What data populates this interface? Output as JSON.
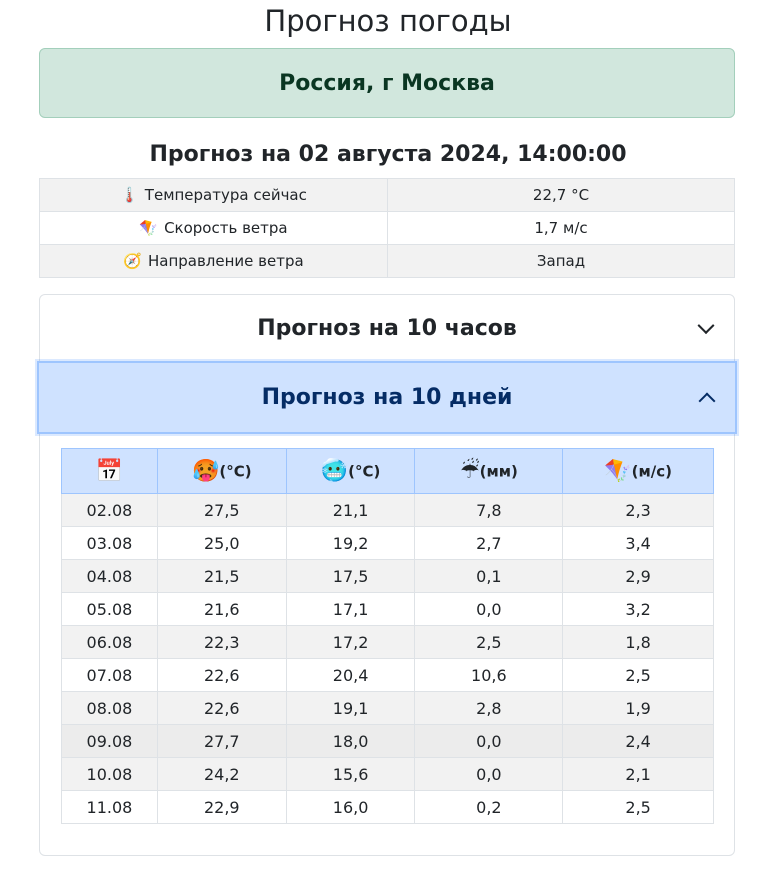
{
  "page_title": "Прогноз погоды",
  "location": "Россия, г Москва",
  "forecast_heading": "Прогноз на 02 августа 2024, 14:00:00",
  "current": [
    {
      "icon": "🌡️",
      "icon_name": "thermometer-icon",
      "label": "Температура сейчас",
      "value": "22,7 °C"
    },
    {
      "icon": "🪁",
      "icon_name": "kite-icon",
      "label": "Скорость ветра",
      "value": "1,7 м/с"
    },
    {
      "icon": "🧭",
      "icon_name": "compass-icon",
      "label": "Направление ветра",
      "value": "Запад"
    }
  ],
  "accordion": {
    "hourly_title": "Прогноз на 10 часов",
    "daily_title": "Прогноз на 10 дней"
  },
  "daily_table": {
    "headers": [
      {
        "icon": "📅",
        "icon_name": "calendar-icon",
        "unit": ""
      },
      {
        "icon": "🥵",
        "icon_name": "hot-face-icon",
        "unit": "(°C)"
      },
      {
        "icon": "🥶",
        "icon_name": "cold-face-icon",
        "unit": "(°C)"
      },
      {
        "icon": "☔",
        "icon_name": "umbrella-rain-icon",
        "unit": "(мм)"
      },
      {
        "icon": "🪁",
        "icon_name": "kite-icon",
        "unit": "(м/с)"
      }
    ],
    "rows": [
      [
        "02.08",
        "27,5",
        "21,1",
        "7,8",
        "2,3"
      ],
      [
        "03.08",
        "25,0",
        "19,2",
        "2,7",
        "3,4"
      ],
      [
        "04.08",
        "21,5",
        "17,5",
        "0,1",
        "2,9"
      ],
      [
        "05.08",
        "21,6",
        "17,1",
        "0,0",
        "3,2"
      ],
      [
        "06.08",
        "22,3",
        "17,2",
        "2,5",
        "1,8"
      ],
      [
        "07.08",
        "22,6",
        "20,4",
        "10,6",
        "2,5"
      ],
      [
        "08.08",
        "22,6",
        "19,1",
        "2,8",
        "1,9"
      ],
      [
        "09.08",
        "27,7",
        "18,0",
        "0,0",
        "2,4"
      ],
      [
        "10.08",
        "24,2",
        "15,6",
        "0,0",
        "2,1"
      ],
      [
        "11.08",
        "22,9",
        "16,0",
        "0,2",
        "2,5"
      ]
    ]
  }
}
